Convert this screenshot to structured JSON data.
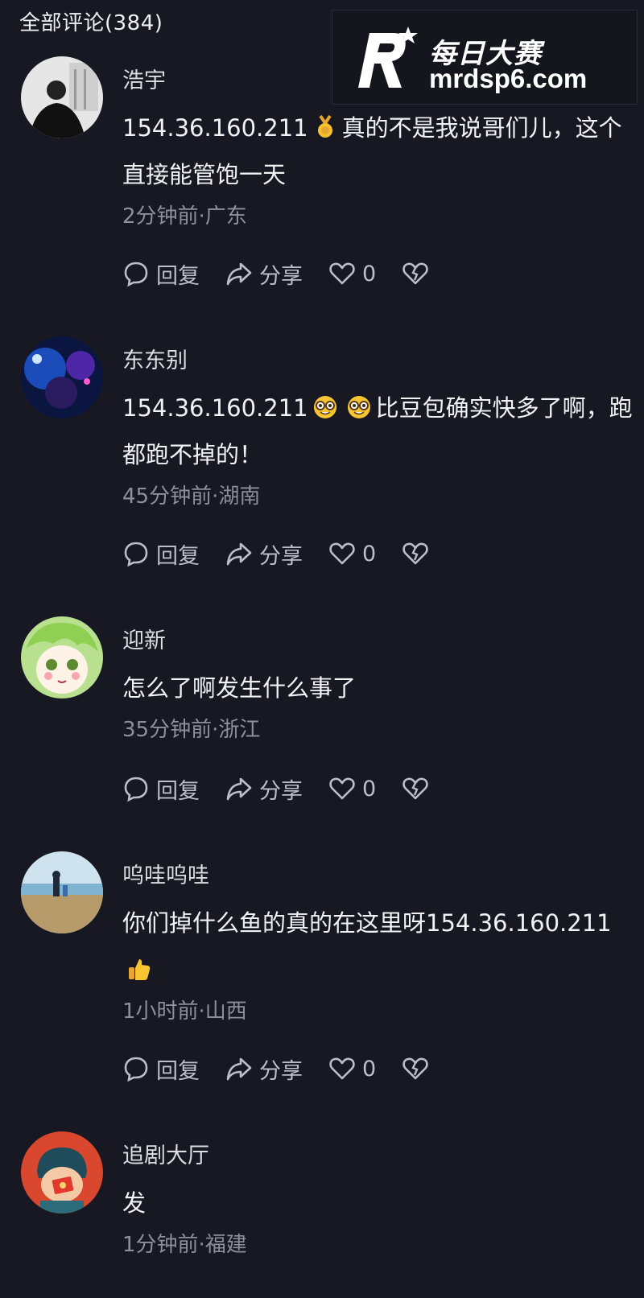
{
  "header": {
    "title": "全部评论(384)"
  },
  "watermark": {
    "brand": "每日大赛",
    "url": "mrdsp6.com"
  },
  "actions": {
    "reply": "回复",
    "share": "分享"
  },
  "comments": [
    {
      "username": "浩宇",
      "text_before": "154.36.160.211",
      "emoji": "medal-icon",
      "text_after": "真的不是我说哥们儿，这个直接能管饱一天",
      "meta": "2分钟前·广东",
      "likes": "0"
    },
    {
      "username": "东东别",
      "text_before": "154.36.160.211",
      "emoji": "nerd-face-icon",
      "text_after": "比豆包确实快多了啊，跑都跑不掉的！",
      "meta": "45分钟前·湖南",
      "likes": "0"
    },
    {
      "username": "迎新",
      "text": "怎么了啊发生什么事了",
      "meta": "35分钟前·浙江",
      "likes": "0"
    },
    {
      "username": "呜哇呜哇",
      "text_before": "你们掉什么鱼的真的在这里呀154.36.160.211",
      "emoji": "thumbs-up-icon",
      "meta": "1小时前·山西",
      "likes": "0"
    },
    {
      "username": "追剧大厅",
      "text": "发",
      "meta": "1分钟前·福建"
    }
  ],
  "colors": {
    "background": "#171822",
    "text": "#f2f2f5",
    "meta": "#8e8f9a"
  }
}
